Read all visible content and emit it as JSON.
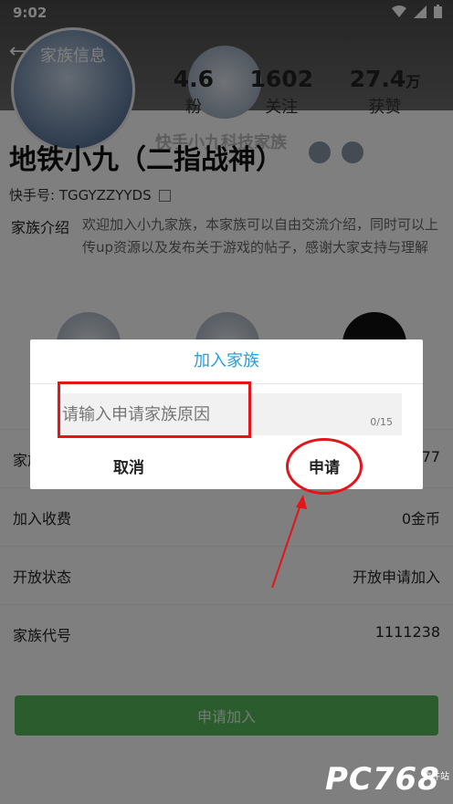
{
  "status_bar": {
    "time": "9:02"
  },
  "topbar": {
    "title": "家族信息"
  },
  "stats": [
    {
      "num": "4.6",
      "suffix": "",
      "label": "粉"
    },
    {
      "num": "1602",
      "suffix": "",
      "label": "关注"
    },
    {
      "num": "27.4",
      "suffix": "万",
      "label": "获赞"
    }
  ],
  "family_tag": "快手小九科技家族",
  "profile": {
    "name": "地铁小九（二指战神）",
    "kuaishou_id": "快手号: TGGYZZYYDS"
  },
  "intro": {
    "label": "家族介绍",
    "text": "欢迎加入小九家族，本家族可以自由交流介绍，同时可以上传up资源以及发布关于游戏的帖子，感谢大家支持与理解"
  },
  "rows": [
    {
      "label": "家族",
      "value": "77"
    },
    {
      "label": "加入收费",
      "value": "0金币"
    },
    {
      "label": "开放状态",
      "value": "开放申请加入"
    },
    {
      "label": "家族代号",
      "value": "1111238"
    }
  ],
  "apply_button": "申请加入",
  "dialog": {
    "title": "加入家族",
    "placeholder": "请输入申请家族原因",
    "counter": "0/15",
    "cancel": "取消",
    "confirm": "申请"
  },
  "watermark": {
    "brand": "PC768",
    "sub": "软件站"
  },
  "colors": {
    "accent": "#2e9ad6",
    "highlight": "#e3141a",
    "button_green": "#57b95c"
  }
}
